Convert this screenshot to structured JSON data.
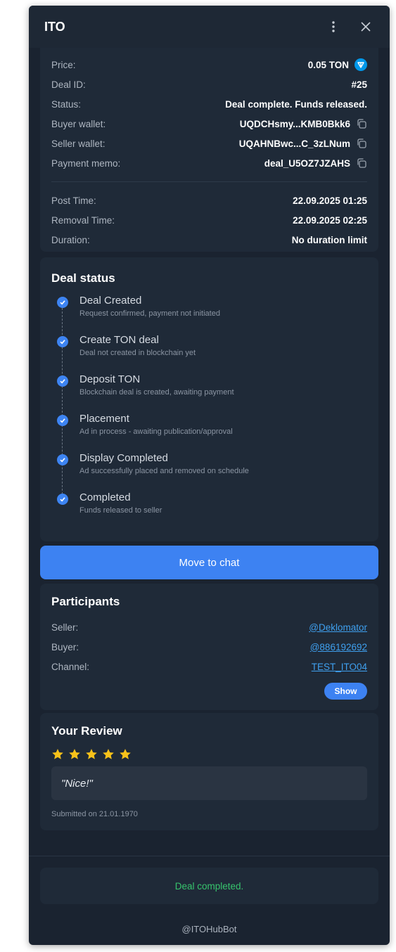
{
  "header": {
    "title": "ITO"
  },
  "details": {
    "rows": [
      {
        "label": "Price:",
        "value": "0.05 TON",
        "icon": "ton-icon"
      },
      {
        "label": "Deal ID:",
        "value": "#25"
      },
      {
        "label": "Status:",
        "value": "Deal complete. Funds released."
      },
      {
        "label": "Buyer wallet:",
        "value": "UQDCHsmy...KMB0Bkk6",
        "copy": true
      },
      {
        "label": "Seller wallet:",
        "value": "UQAHNBwc...C_3zLNum",
        "copy": true
      },
      {
        "label": "Payment memo:",
        "value": "deal_U5OZ7JZAHS",
        "copy": true
      }
    ],
    "time_rows": [
      {
        "label": "Post Time:",
        "value": "22.09.2025 01:25"
      },
      {
        "label": "Removal Time:",
        "value": "22.09.2025 02:25"
      },
      {
        "label": "Duration:",
        "value": "No duration limit"
      }
    ]
  },
  "deal_status": {
    "title": "Deal status",
    "steps": [
      {
        "title": "Deal Created",
        "subtitle": "Request confirmed, payment not initiated"
      },
      {
        "title": "Create TON deal",
        "subtitle": "Deal not created in blockchain yet"
      },
      {
        "title": "Deposit TON",
        "subtitle": "Blockchain deal is created, awaiting payment"
      },
      {
        "title": "Placement",
        "subtitle": "Ad in process - awaiting publication/approval"
      },
      {
        "title": "Display Completed",
        "subtitle": "Ad successfully placed and removed on schedule"
      },
      {
        "title": "Completed",
        "subtitle": "Funds released to seller"
      }
    ]
  },
  "chat_button": {
    "label": "Move to chat"
  },
  "participants": {
    "title": "Participants",
    "seller_label": "Seller:",
    "seller": "@Deklomator",
    "buyer_label": "Buyer:",
    "buyer": "@886192692",
    "channel_label": "Channel:",
    "channel": "TEST_ITO04",
    "show_label": "Show"
  },
  "review": {
    "title": "Your Review",
    "rating": 5,
    "text": "\"Nice!\"",
    "submitted": "Submitted on 21.01.1970"
  },
  "status_message": "Deal completed.",
  "bot_name": "@ITOHubBot",
  "colors": {
    "accent": "#3d82f2",
    "success": "#37c46d",
    "link": "#3fa0ef",
    "star": "#f7c21a",
    "background": "#1a2330"
  }
}
